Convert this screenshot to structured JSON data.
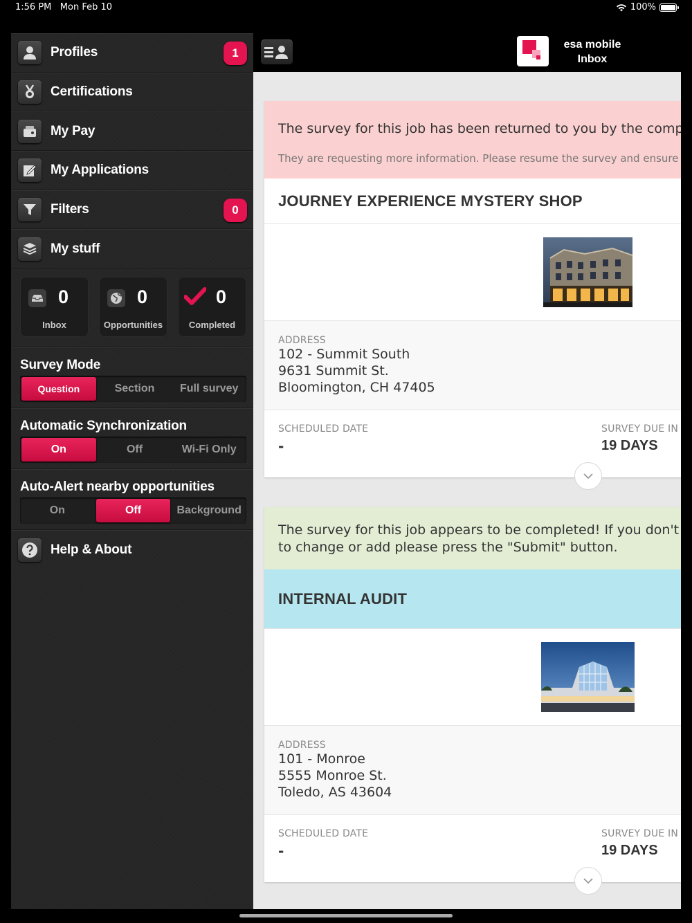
{
  "status_bar": {
    "time": "1:56 PM",
    "date": "Mon Feb 10",
    "battery": "100%"
  },
  "menu": [
    {
      "label": "Profiles",
      "icon": "person-icon",
      "badge": "1"
    },
    {
      "label": "Certifications",
      "icon": "medal-icon"
    },
    {
      "label": "My Pay",
      "icon": "wallet-icon"
    },
    {
      "label": "My Applications",
      "icon": "edit-form-icon"
    },
    {
      "label": "Filters",
      "icon": "funnel-icon",
      "badge": "0"
    },
    {
      "label": "My stuff",
      "icon": "boxes-icon"
    }
  ],
  "counters": [
    {
      "value": "0",
      "label": "Inbox",
      "icon": "inbox-icon"
    },
    {
      "value": "0",
      "label": "Opportunities",
      "icon": "globe-icon"
    },
    {
      "value": "0",
      "label": "Completed",
      "icon": "checkmark-icon"
    }
  ],
  "survey_mode": {
    "title": "Survey Mode",
    "options": [
      "Question",
      "Section",
      "Full survey"
    ],
    "selected": "Question"
  },
  "auto_sync": {
    "title": "Automatic Synchronization",
    "options": [
      "On",
      "Off",
      "Wi-Fi Only"
    ],
    "selected": "On"
  },
  "auto_alert": {
    "title": "Auto-Alert nearby opportunities",
    "options": [
      "On",
      "Off",
      "Background"
    ],
    "selected": "Off"
  },
  "help": {
    "label": "Help & About",
    "icon": "question-icon"
  },
  "topbar": {
    "app_name": "esa mobile",
    "screen": "Inbox"
  },
  "jobs": [
    {
      "banner_line1": "The survey for this job has been returned to you by the compa",
      "banner_line2": "They are requesting more information. Please resume the survey and ensure its c",
      "title": "JOURNEY EXPERIENCE MYSTERY SHOP",
      "address_label": "ADDRESS",
      "address": [
        "102 - Summit South",
        "9631 Summit St.",
        "Bloomington, CH 47405"
      ],
      "scheduled_label": "SCHEDULED DATE",
      "scheduled_value": "-",
      "due_label": "SURVEY DUE IN",
      "due_value": "19 DAYS"
    },
    {
      "banner_line1": "The survey for this job appears to be completed! If you don't h",
      "banner_line2": "to change or add please press the \"Submit\" button.",
      "title": "INTERNAL AUDIT",
      "address_label": "ADDRESS",
      "address": [
        "101 - Monroe",
        "5555 Monroe St.",
        "Toledo, AS 43604"
      ],
      "scheduled_label": "SCHEDULED DATE",
      "scheduled_value": "-",
      "due_label": "SURVEY DUE IN",
      "due_value": "19 DAYS"
    }
  ],
  "colors": {
    "accent": "#e3144f",
    "returned_banner": "#fbd0d0",
    "complete_banner": "#e2edd4",
    "audit_header": "#b6e6ef"
  }
}
